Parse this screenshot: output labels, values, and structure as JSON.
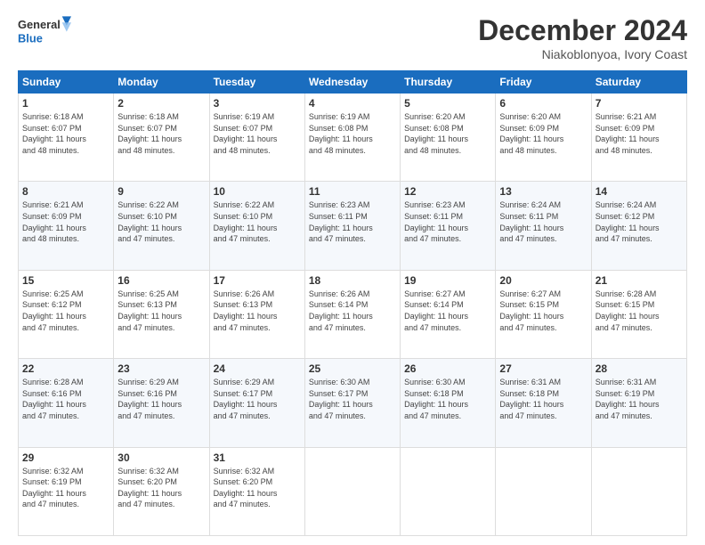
{
  "logo": {
    "line1": "General",
    "line2": "Blue"
  },
  "title": "December 2024",
  "subtitle": "Niakoblonyoa, Ivory Coast",
  "header_days": [
    "Sunday",
    "Monday",
    "Tuesday",
    "Wednesday",
    "Thursday",
    "Friday",
    "Saturday"
  ],
  "weeks": [
    [
      {
        "day": "1",
        "info": "Sunrise: 6:18 AM\nSunset: 6:07 PM\nDaylight: 11 hours\nand 48 minutes."
      },
      {
        "day": "2",
        "info": "Sunrise: 6:18 AM\nSunset: 6:07 PM\nDaylight: 11 hours\nand 48 minutes."
      },
      {
        "day": "3",
        "info": "Sunrise: 6:19 AM\nSunset: 6:07 PM\nDaylight: 11 hours\nand 48 minutes."
      },
      {
        "day": "4",
        "info": "Sunrise: 6:19 AM\nSunset: 6:08 PM\nDaylight: 11 hours\nand 48 minutes."
      },
      {
        "day": "5",
        "info": "Sunrise: 6:20 AM\nSunset: 6:08 PM\nDaylight: 11 hours\nand 48 minutes."
      },
      {
        "day": "6",
        "info": "Sunrise: 6:20 AM\nSunset: 6:09 PM\nDaylight: 11 hours\nand 48 minutes."
      },
      {
        "day": "7",
        "info": "Sunrise: 6:21 AM\nSunset: 6:09 PM\nDaylight: 11 hours\nand 48 minutes."
      }
    ],
    [
      {
        "day": "8",
        "info": "Sunrise: 6:21 AM\nSunset: 6:09 PM\nDaylight: 11 hours\nand 48 minutes."
      },
      {
        "day": "9",
        "info": "Sunrise: 6:22 AM\nSunset: 6:10 PM\nDaylight: 11 hours\nand 47 minutes."
      },
      {
        "day": "10",
        "info": "Sunrise: 6:22 AM\nSunset: 6:10 PM\nDaylight: 11 hours\nand 47 minutes."
      },
      {
        "day": "11",
        "info": "Sunrise: 6:23 AM\nSunset: 6:11 PM\nDaylight: 11 hours\nand 47 minutes."
      },
      {
        "day": "12",
        "info": "Sunrise: 6:23 AM\nSunset: 6:11 PM\nDaylight: 11 hours\nand 47 minutes."
      },
      {
        "day": "13",
        "info": "Sunrise: 6:24 AM\nSunset: 6:11 PM\nDaylight: 11 hours\nand 47 minutes."
      },
      {
        "day": "14",
        "info": "Sunrise: 6:24 AM\nSunset: 6:12 PM\nDaylight: 11 hours\nand 47 minutes."
      }
    ],
    [
      {
        "day": "15",
        "info": "Sunrise: 6:25 AM\nSunset: 6:12 PM\nDaylight: 11 hours\nand 47 minutes."
      },
      {
        "day": "16",
        "info": "Sunrise: 6:25 AM\nSunset: 6:13 PM\nDaylight: 11 hours\nand 47 minutes."
      },
      {
        "day": "17",
        "info": "Sunrise: 6:26 AM\nSunset: 6:13 PM\nDaylight: 11 hours\nand 47 minutes."
      },
      {
        "day": "18",
        "info": "Sunrise: 6:26 AM\nSunset: 6:14 PM\nDaylight: 11 hours\nand 47 minutes."
      },
      {
        "day": "19",
        "info": "Sunrise: 6:27 AM\nSunset: 6:14 PM\nDaylight: 11 hours\nand 47 minutes."
      },
      {
        "day": "20",
        "info": "Sunrise: 6:27 AM\nSunset: 6:15 PM\nDaylight: 11 hours\nand 47 minutes."
      },
      {
        "day": "21",
        "info": "Sunrise: 6:28 AM\nSunset: 6:15 PM\nDaylight: 11 hours\nand 47 minutes."
      }
    ],
    [
      {
        "day": "22",
        "info": "Sunrise: 6:28 AM\nSunset: 6:16 PM\nDaylight: 11 hours\nand 47 minutes."
      },
      {
        "day": "23",
        "info": "Sunrise: 6:29 AM\nSunset: 6:16 PM\nDaylight: 11 hours\nand 47 minutes."
      },
      {
        "day": "24",
        "info": "Sunrise: 6:29 AM\nSunset: 6:17 PM\nDaylight: 11 hours\nand 47 minutes."
      },
      {
        "day": "25",
        "info": "Sunrise: 6:30 AM\nSunset: 6:17 PM\nDaylight: 11 hours\nand 47 minutes."
      },
      {
        "day": "26",
        "info": "Sunrise: 6:30 AM\nSunset: 6:18 PM\nDaylight: 11 hours\nand 47 minutes."
      },
      {
        "day": "27",
        "info": "Sunrise: 6:31 AM\nSunset: 6:18 PM\nDaylight: 11 hours\nand 47 minutes."
      },
      {
        "day": "28",
        "info": "Sunrise: 6:31 AM\nSunset: 6:19 PM\nDaylight: 11 hours\nand 47 minutes."
      }
    ],
    [
      {
        "day": "29",
        "info": "Sunrise: 6:32 AM\nSunset: 6:19 PM\nDaylight: 11 hours\nand 47 minutes."
      },
      {
        "day": "30",
        "info": "Sunrise: 6:32 AM\nSunset: 6:20 PM\nDaylight: 11 hours\nand 47 minutes."
      },
      {
        "day": "31",
        "info": "Sunrise: 6:32 AM\nSunset: 6:20 PM\nDaylight: 11 hours\nand 47 minutes."
      },
      null,
      null,
      null,
      null
    ]
  ]
}
